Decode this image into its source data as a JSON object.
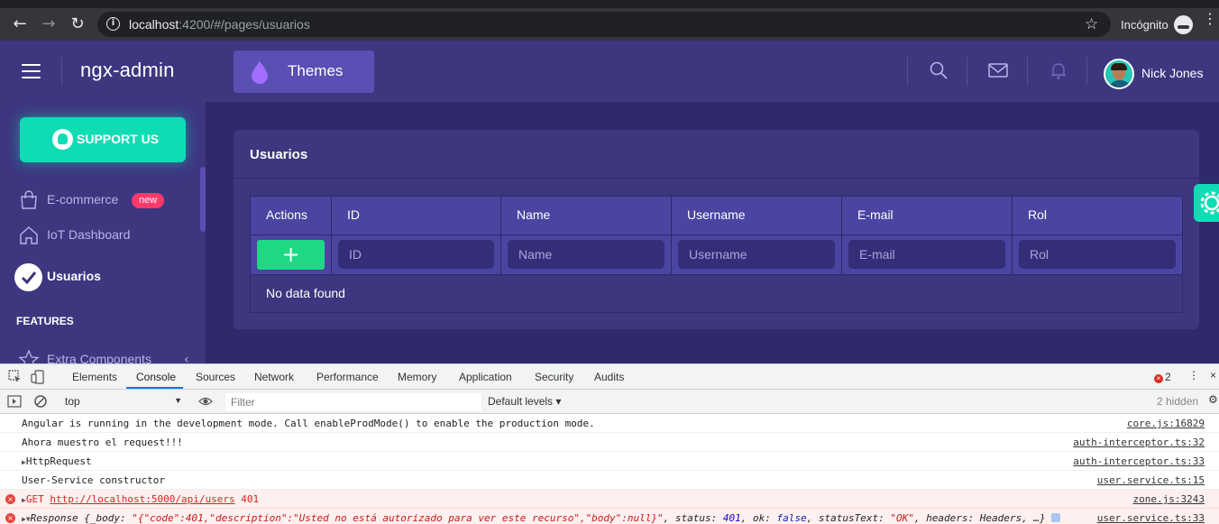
{
  "browser": {
    "url_host": "localhost",
    "url_rest": ":4200/#/pages/usuarios",
    "incognito_label": "Incógnito"
  },
  "header": {
    "logo": "ngx-admin",
    "themes_label": "Themes",
    "user_name": "Nick Jones"
  },
  "sidebar": {
    "support_label": "SUPPORT US",
    "items": [
      {
        "label": "E-commerce",
        "badge": "new",
        "icon": "cart-icon"
      },
      {
        "label": "IoT Dashboard",
        "icon": "home-icon"
      },
      {
        "label": "Usuarios",
        "icon": "check-circle-icon",
        "active": true
      }
    ],
    "features_title": "FEATURES",
    "extra_item": "Extra Components"
  },
  "card": {
    "title": "Usuarios",
    "columns": [
      "Actions",
      "ID",
      "Name",
      "Username",
      "E-mail",
      "Rol"
    ],
    "filters": {
      "id": "ID",
      "name": "Name",
      "username": "Username",
      "email": "E-mail",
      "rol": "Rol"
    },
    "add_label": "+",
    "empty_message": "No data found"
  },
  "devtools": {
    "tabs": [
      "Elements",
      "Console",
      "Sources",
      "Network",
      "Performance",
      "Memory",
      "Application",
      "Security",
      "Audits"
    ],
    "active_tab": "Console",
    "error_count": "2",
    "context": "top",
    "filter_placeholder": "Filter",
    "levels": "Default levels",
    "hidden": "2 hidden",
    "logs": [
      {
        "msg": "Angular is running in the development mode. Call enableProdMode() to enable the production mode.",
        "src": "core.js:16829"
      },
      {
        "msg": "Ahora muestro el request!!!",
        "src": "auth-interceptor.ts:32"
      },
      {
        "msg": "HttpRequest",
        "src": "auth-interceptor.ts:33"
      },
      {
        "msg": "User-Service constructor",
        "src": "user.service.ts:15"
      },
      {
        "method": "GET",
        "url": "http://localhost:5000/api/users",
        "status": "401",
        "src": "zone.js:3243"
      },
      {
        "prefix": "Response {_body: ",
        "body": "\"{\"code\":401,\"description\":\"Usted no está autorizado para ver este recurso\",\"body\":null}\"",
        "status_key": ", status: ",
        "status_val": "401",
        "ok_key": ", ok: ",
        "ok_val": "false",
        "st_key": ", statusText: ",
        "st_val": "\"OK\"",
        "tail": ", headers: Headers, …}",
        "src": "user.service.ts:33"
      }
    ]
  },
  "colors": {
    "header_bg": "#3d3780",
    "page_bg": "#2f2a6b",
    "accent_green": "#1fd883",
    "support_teal": "#10dcb4",
    "badge_red": "#ff386a"
  }
}
